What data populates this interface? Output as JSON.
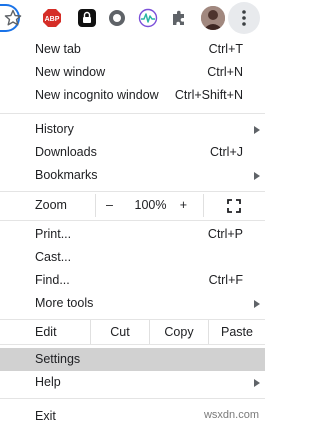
{
  "toolbar": {
    "extensions": [
      {
        "name": "adblock-plus-icon",
        "label": "ABP",
        "color": "#d52d27"
      },
      {
        "name": "lock-extension-icon"
      },
      {
        "name": "ring-extension-icon"
      },
      {
        "name": "wave-extension-icon",
        "color": "#7b4fd9"
      },
      {
        "name": "puzzle-icon"
      }
    ],
    "accent": "#1a73e8"
  },
  "menu": {
    "new_tab": {
      "label": "New tab",
      "shortcut": "Ctrl+T"
    },
    "new_window": {
      "label": "New window",
      "shortcut": "Ctrl+N"
    },
    "new_incognito": {
      "label": "New incognito window",
      "shortcut": "Ctrl+Shift+N"
    },
    "history": {
      "label": "History"
    },
    "downloads": {
      "label": "Downloads",
      "shortcut": "Ctrl+J"
    },
    "bookmarks": {
      "label": "Bookmarks"
    },
    "zoom": {
      "label": "Zoom",
      "minus": "–",
      "value": "100%",
      "plus": "+"
    },
    "print": {
      "label": "Print...",
      "shortcut": "Ctrl+P"
    },
    "cast": {
      "label": "Cast..."
    },
    "find": {
      "label": "Find...",
      "shortcut": "Ctrl+F"
    },
    "more_tools": {
      "label": "More tools"
    },
    "edit": {
      "label": "Edit",
      "cut": "Cut",
      "copy": "Copy",
      "paste": "Paste"
    },
    "settings": {
      "label": "Settings"
    },
    "help": {
      "label": "Help"
    },
    "exit": {
      "label": "Exit"
    },
    "hover_color": "#d1d1d1"
  },
  "watermark": "wsxdn.com"
}
